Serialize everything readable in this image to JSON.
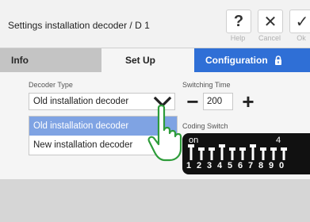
{
  "header": {
    "title": "Settings installation decoder / D 1",
    "help_symbol": "?",
    "help_label": "Help",
    "cancel_symbol": "✕",
    "cancel_label": "Cancel",
    "ok_symbol": "✓",
    "ok_label": "Ok"
  },
  "tabs": [
    {
      "label": "Info",
      "active": false
    },
    {
      "label": "Set Up",
      "active": true
    },
    {
      "label": "Configuration",
      "active": false,
      "locked": true,
      "icon": "lock-icon"
    }
  ],
  "decoder_type": {
    "label": "Decoder Type",
    "value": "Old installation decoder",
    "options": [
      "Old installation decoder",
      "New installation decoder"
    ],
    "selected_index": 0
  },
  "switching_time": {
    "label": "Switching Time",
    "value": "200",
    "minus": "−",
    "plus": "+"
  },
  "coding_switch": {
    "label": "Coding Switch",
    "on_label": "on",
    "marker": "4",
    "numbers": [
      "1",
      "2",
      "3",
      "4",
      "5",
      "6",
      "7",
      "8",
      "9",
      "0"
    ],
    "on_states": [
      true,
      false,
      false,
      true,
      false,
      false,
      true,
      false,
      false,
      false
    ]
  },
  "colors": {
    "accent": "#2f6fd6",
    "selected_option": "#7fa3e3",
    "hand_outline": "#2e9c3a"
  }
}
